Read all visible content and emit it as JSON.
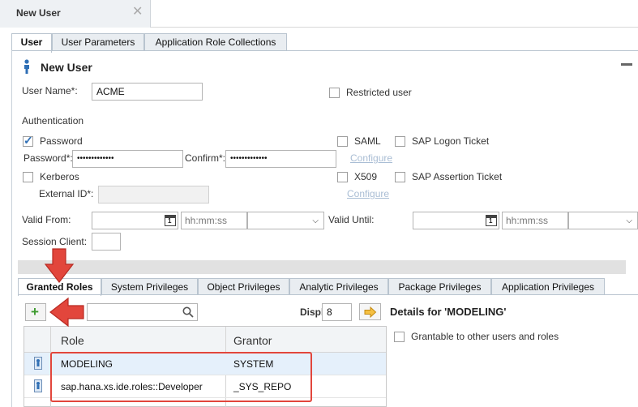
{
  "editor_tab": {
    "title": "New User",
    "close_glyph": "✕"
  },
  "top_tabs": [
    "User",
    "User Parameters",
    "Application Role Collections"
  ],
  "header": {
    "title": "New User"
  },
  "form": {
    "user_name_label": "User Name*:",
    "user_name_value": "ACME",
    "restricted_label": "Restricted user",
    "auth_heading": "Authentication",
    "password_label": "Password",
    "password_field_label": "Password*:",
    "password_value": "•••••••••••••",
    "confirm_label": "Confirm*:",
    "confirm_value": "•••••••••••••",
    "saml_label": "SAML",
    "configure_1": "Configure",
    "sap_logon_label": "SAP Logon Ticket",
    "kerberos_label": "Kerberos",
    "external_id_label": "External ID*:",
    "x509_label": "X509",
    "configure_2": "Configure",
    "sap_assertion_label": "SAP Assertion Ticket",
    "valid_from_label": "Valid From:",
    "valid_until_label": "Valid Until:",
    "time_placeholder_1": "hh:mm:ss",
    "time_placeholder_2": "hh:mm:ss",
    "calendar_day": "1",
    "session_client_label": "Session Client:"
  },
  "bottom_tabs": [
    "Granted Roles",
    "System Privileges",
    "Object Privileges",
    "Analytic Privileges",
    "Package Privileges",
    "Application Privileges"
  ],
  "toolbar": {
    "display_label": "Display:",
    "display_value": "8"
  },
  "details": {
    "title": "Details for 'MODELING'",
    "grantable_label": "Grantable to other users and roles"
  },
  "table": {
    "columns": [
      "Role",
      "Grantor"
    ],
    "rows": [
      {
        "role": "MODELING",
        "grantor": "SYSTEM"
      },
      {
        "role": "sap.hana.xs.ide.roles::Developer",
        "grantor": "_SYS_REPO"
      }
    ]
  },
  "colors": {
    "accent": "#2f6fb5",
    "annotation": "#e2463c",
    "add_green": "#3d9a2e"
  }
}
